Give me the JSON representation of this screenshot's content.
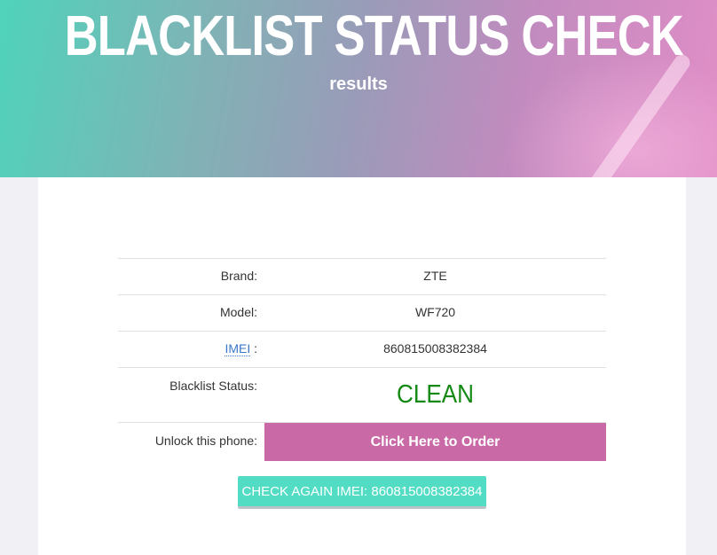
{
  "hero": {
    "title": "BLACKLIST STATUS CHECK",
    "subtitle": "results"
  },
  "results": {
    "brand_label": "Brand:",
    "brand_value": "ZTE",
    "model_label": "Model:",
    "model_value": "WF720",
    "imei_label": "IMEI",
    "imei_suffix": " :",
    "imei_value": "860815008382384",
    "blacklist_label": "Blacklist Status:",
    "blacklist_value": "CLEAN",
    "unlock_label": "Unlock this phone:",
    "order_label": "Click Here to Order"
  },
  "check_again_label": "CHECK AGAIN IMEI: 860815008382384",
  "colors": {
    "clean": "#148a14",
    "order_button": "#c96aa7",
    "check_button": "#52dcc4",
    "imei_link": "#3a78c9"
  }
}
